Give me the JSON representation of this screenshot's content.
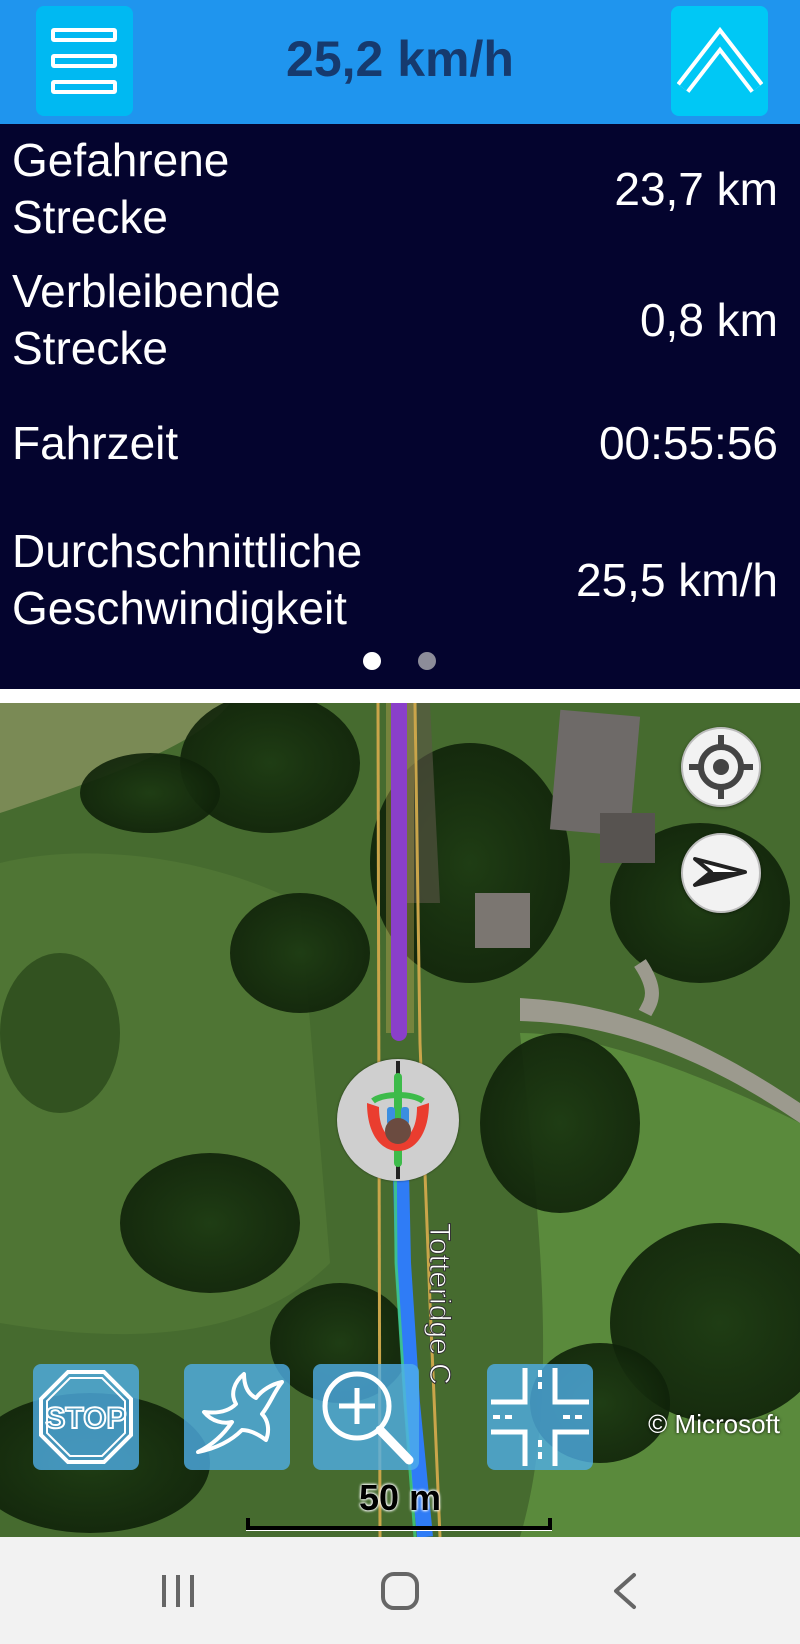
{
  "header": {
    "menu_icon": "hamburger-menu-icon",
    "speed": "25,2 km/h",
    "collapse_icon": "chevron-up-icon",
    "accent_color": "#1f95ee",
    "button_color": "#00c0f3"
  },
  "stats": {
    "rows": [
      {
        "label": "Gefahrene\nStrecke",
        "value": "23,7 km"
      },
      {
        "label": "Verbleibende\nStrecke",
        "value": "0,8 km"
      },
      {
        "label": "Fahrzeit",
        "value": "00:55:56"
      },
      {
        "label": "Durchschnittliche\nGeschwindigkeit",
        "value": "25,5 km/h"
      }
    ],
    "page_indicator": {
      "pages": 2,
      "active": 1
    },
    "background": "#04042e"
  },
  "map": {
    "attribution": "© Microsoft",
    "scale_label": "50 m",
    "street_label": "Totteridge C",
    "route_color_ahead": "#8a3fc9",
    "route_color_behind": "#2f7cf6",
    "buttons": {
      "locate_icon": "crosshair-locate-icon",
      "compass_icon": "compass-arrow-icon",
      "stop_icon": "stop-sign-icon",
      "bird_icon": "dove-icon",
      "zoom_icon": "zoom-in-icon",
      "junction_icon": "intersection-icon"
    }
  },
  "navigation_bar": {
    "recent_icon": "recent-apps-icon",
    "home_icon": "home-icon",
    "back_icon": "back-icon"
  }
}
